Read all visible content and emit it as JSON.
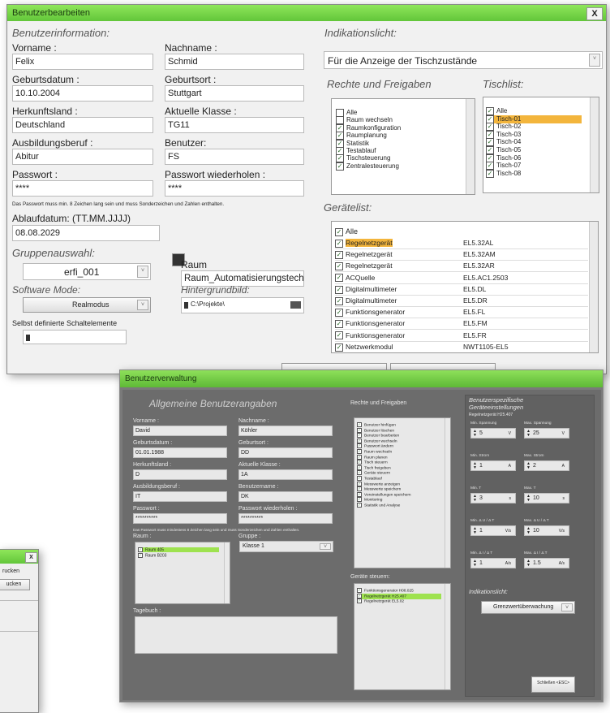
{
  "win1": {
    "title": "Benutzerbearbeiten",
    "close": "X",
    "section_info": "Benutzerinformation:",
    "vorname_label": "Vorname :",
    "vorname": "Felix",
    "nachname_label": "Nachname :",
    "nachname": "Schmid",
    "geburtsdatum_label": "Geburtsdatum :",
    "geburtsdatum": "10.10.2004",
    "geburtsort_label": "Geburtsort :",
    "geburtsort": "Stuttgart",
    "herkunftsland_label": "Herkunftsland :",
    "herkunftsland": "Deutschland",
    "klasse_label": "Aktuelle Klasse :",
    "klasse": "TG11",
    "ausbildung_label": "Ausbildungsberuf :",
    "ausbildung": "Abitur",
    "benutzer_label": "Benutzer:",
    "benutzer": "FS",
    "passwort_label": "Passwort :",
    "passwort": "****",
    "passwort2_label": "Passwort wiederholen :",
    "passwort2": "****",
    "passwort_hint": "Das Passwort muss min. 8 Zeichen lang sein und muss Sonderzeichen und Zahlen enthalten.",
    "ablauf_label": "Ablaufdatum: (TT.MM.JJJJ)",
    "ablauf": "08.08.2029",
    "gruppe_label": "Gruppenauswahl:",
    "gruppe": "erfi_001",
    "raum_label": "Raum",
    "raum": "Raum_Automatisierungstech",
    "software_label": "Software Mode:",
    "software": "Realmodus",
    "hintergrund_label": "Hintergrundbild:",
    "hintergrund": "C:\\Projekte\\",
    "schalt_label": "Selbst definierte Schaltelemente",
    "indikation_label": "Indikationslicht:",
    "indikation": "Für die Anzeige der Tischzustände",
    "rechte_label": "Rechte und Freigaben",
    "tischlist_label": "Tischlist:",
    "rechte": [
      "Alle",
      "Raum wechseln",
      "Raumkonfiguration",
      "Raumplanung",
      "Statistik",
      "Testablauf",
      "Tischsteuerung",
      "Zentralesteuerung"
    ],
    "tische": [
      "Alle",
      "Tisch-01",
      "Tisch-02",
      "Tisch-03",
      "Tisch-04",
      "Tisch-05",
      "Tisch-06",
      "Tisch-07",
      "Tisch-08"
    ],
    "geraete_label": "Gerätelist:",
    "geraete_alle": "Alle",
    "geraete": [
      {
        "name": "Regelnetzgerät",
        "code": "EL5.32AL"
      },
      {
        "name": "Regelnetzgerät",
        "code": "EL5.32AM"
      },
      {
        "name": "Regelnetzgerät",
        "code": "EL5.32AR"
      },
      {
        "name": "ACQuelle",
        "code": "EL5.AC1.2503"
      },
      {
        "name": "Digitalmultimeter",
        "code": "EL5.DL"
      },
      {
        "name": "Digitalmultimeter",
        "code": "EL5.DR"
      },
      {
        "name": "Funktionsgenerator",
        "code": "EL5.FL"
      },
      {
        "name": "Funktionsgenerator",
        "code": "EL5.FM"
      },
      {
        "name": "Funktionsgenerator",
        "code": "EL5.FR"
      },
      {
        "name": "Netzwerkmodul",
        "code": "NWT1105-EL5"
      }
    ]
  },
  "win2": {
    "title": "Benutzerverwaltung",
    "section": "Allgemeine Benutzerangaben",
    "vorname_label": "Vorname :",
    "vorname": "David",
    "nachname_label": "Nachname :",
    "nachname": "Köhler",
    "geburtsdatum_label": "Geburtsdatum :",
    "geburtsdatum": "01.01.1988",
    "geburtsort_label": "Geburtsort :",
    "geburtsort": "DD",
    "herkunft_label": "Herkunftsland :",
    "herkunft": "D",
    "klasse_label": "Aktuelle Klasse :",
    "klasse": "1A",
    "ausbildung_label": "Ausbildungsberuf :",
    "ausbildung": "IT",
    "benutzername_label": "Benutzername :",
    "benutzername": "DK",
    "passwort_label": "Passwort :",
    "passwort": "**********",
    "passwort2_label": "Passwort wiederholen :",
    "passwort2": "**********",
    "hint": "Das Passwort muss mindestens 8 Zeichen lang sein und muss Sonderzeichen und Zahlen enthalten.",
    "raum_label": "Raum :",
    "raeume": [
      "Raum 405",
      "Raum B203"
    ],
    "gruppe_label": "Gruppe :",
    "gruppe": "Klasse 1",
    "tagebuch_label": "Tagebuch :",
    "rechte_label": "Rechte und Freigaben",
    "rechte": [
      "Benutzer hinfügen",
      "Benutzer löschen",
      "Benutzer bearbeiten",
      "Benutzer wechseln",
      "Passwort ändern",
      "Raum wechseln",
      "Raum planen",
      "Tisch steuern",
      "Tisch freigeben",
      "Geräte steuern",
      "Testablauf",
      "Messwerte anzeigen",
      "Messwerte speichern",
      "Voreinstellungen speichern",
      "Monitoring",
      "Statistik und Analyse"
    ],
    "geraete_label": "Geräte steuern:",
    "geraete": [
      "Funktionsgenerator H08.025",
      "Regelnetzgerät H25.407",
      "Regelnetzgerät EL5.02"
    ],
    "spez_label": "Benutzerspezifische Geräteeinstellungen",
    "spez_sub": "Regelnetzgerät H25.407",
    "min_spannung_label": "Min. Spannung",
    "min_spannung": "5",
    "min_spannung_unit": "V",
    "max_spannung_label": "Max. Spannung",
    "max_spannung": "25",
    "max_spannung_unit": "V",
    "min_strom_label": "Min. Strom",
    "min_strom": "1",
    "min_strom_unit": "A",
    "max_strom_label": "Max. Strom",
    "max_strom": "2",
    "max_strom_unit": "A",
    "min_t_label": "Min. T",
    "min_t": "3",
    "min_t_unit": "s",
    "max_t_label": "Max. T",
    "max_t": "10",
    "max_t_unit": "s",
    "min_du_label": "Min. Δ U / Δ T",
    "min_du": "1",
    "min_du_unit": "V/s",
    "max_du_label": "Max. Δ U / Δ T",
    "max_du": "10",
    "max_du_unit": "V/s",
    "min_di_label": "Min. Δ I / Δ T",
    "min_di": "1",
    "min_di_unit": "A/s",
    "max_di_label": "Max. Δ I / Δ T",
    "max_di": "1.5",
    "max_di_unit": "A/s",
    "indikation_label": "Indikationslicht:",
    "indikation": "Grenzwertüberwachung",
    "close_btn": "Schließen <ESC>"
  },
  "win3": {
    "close": "X",
    "text": "rucken",
    "button": "ucken"
  }
}
